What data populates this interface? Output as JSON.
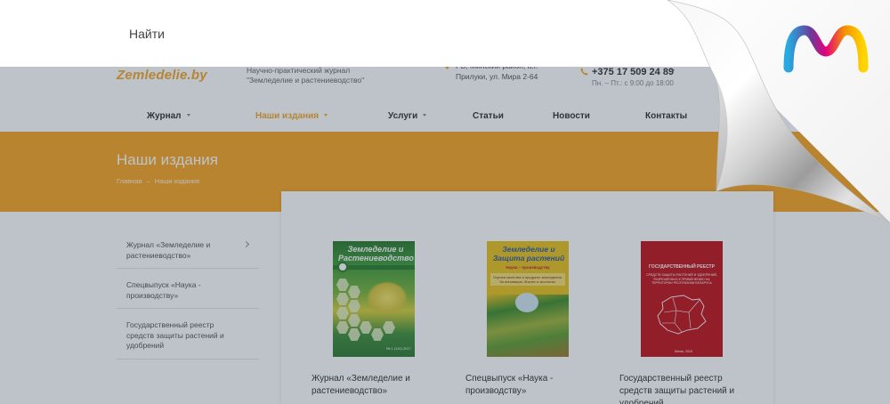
{
  "search": {
    "placeholder": "Найти"
  },
  "header": {
    "logo": "Zemledelie.by",
    "tagline": "Научно-практический журнал \"Земледелие и растениеводство\"",
    "address": "РБ, Минский район, а.г. Прилуки, ул. Мира 2-64",
    "phone": "+375 17 509 24 89",
    "hours": "Пн. – Пт.: с 9:00 до 18:00"
  },
  "nav": {
    "items": [
      {
        "label": "Журнал",
        "has_dropdown": true,
        "active": false
      },
      {
        "label": "Наши издания",
        "has_dropdown": true,
        "active": true
      },
      {
        "label": "Услуги",
        "has_dropdown": true,
        "active": false
      },
      {
        "label": "Статьи",
        "has_dropdown": false,
        "active": false
      },
      {
        "label": "Новости",
        "has_dropdown": false,
        "active": false
      },
      {
        "label": "Контакты",
        "has_dropdown": false,
        "active": false
      }
    ]
  },
  "banner": {
    "title": "Наши издания",
    "breadcrumbs": [
      "Главная",
      "Наши издания"
    ]
  },
  "sidebar": {
    "items": [
      {
        "label": "Журнал «Земледелие и растениеводство»",
        "has_arrow": true
      },
      {
        "label": "Спецвыпуск «Наука - производству»",
        "has_arrow": false
      },
      {
        "label": "Государственный реестр средств защиты растений и удобрений",
        "has_arrow": false
      }
    ]
  },
  "publications": [
    {
      "title": "Журнал «Земледелие и растениеводство»",
      "cover_title": "Земледелие и Растениеводство",
      "cover_foot": "№ 1 (110) 2017"
    },
    {
      "title": "Спецвыпуск «Наука - производству»",
      "cover_title": "Земледелие и Защита растений",
      "cover_red": "Наука – производству",
      "cover_strip": "Оценка качества и продукты земледелия. За инновации, бизнес и экологию."
    },
    {
      "title": "Государственный реестр средств защиты растений и удобрений",
      "cover_title": "ГОСУДАРСТВЕННЫЙ РЕЕСТР",
      "cover_sub": "СРЕДСТВ ЗАЩИТЫ РАСТЕНИЙ И УДОБРЕНИЙ, РАЗРЕШЕННЫХ К ПРИМЕНЕНИЮ НА ТЕРРИТОРИИ РЕСПУБЛИКИ БЕЛАРУСЬ",
      "cover_foot": "Минск, 2018"
    }
  ],
  "colors": {
    "accent": "#f6a524",
    "overlay": "#28374b",
    "link_active": "#f2a72a"
  },
  "icons": {
    "peel": "page-curl-icon",
    "brand": "brand-m-logo-icon"
  }
}
